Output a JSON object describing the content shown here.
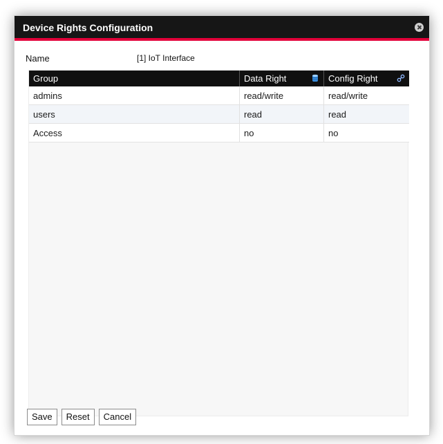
{
  "dialog": {
    "title": "Device Rights Configuration",
    "close_icon": "close-circle-icon"
  },
  "name_row": {
    "label": "Name",
    "value": "[1] IoT Interface"
  },
  "table": {
    "columns": [
      {
        "label": "Group"
      },
      {
        "label": "Data Right",
        "icon": "database-icon"
      },
      {
        "label": "Config Right",
        "icon": "link-icon"
      }
    ],
    "rows": [
      {
        "group": "admins",
        "data_right": "read/write",
        "config_right": "read/write"
      },
      {
        "group": "users",
        "data_right": "read",
        "config_right": "read"
      },
      {
        "group": "Access",
        "data_right": "no",
        "config_right": "no"
      }
    ]
  },
  "buttons": {
    "save": "Save",
    "reset": "Reset",
    "cancel": "Cancel"
  },
  "colors": {
    "title_bar": "#161616",
    "accent": "#e3003a",
    "header": "#101010"
  }
}
